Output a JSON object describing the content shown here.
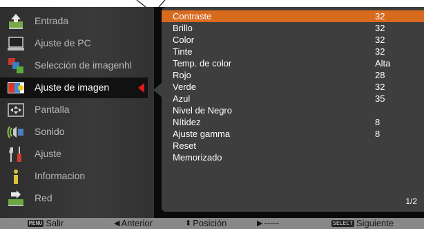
{
  "menu": {
    "items": [
      {
        "label": "Entrada",
        "icon": "input-icon",
        "active": false
      },
      {
        "label": "Ajuste de PC",
        "icon": "pc-icon",
        "active": false
      },
      {
        "label": "Selección de imagenhl",
        "icon": "image-select-icon",
        "active": false
      },
      {
        "label": "Ajuste de imagen",
        "icon": "image-adjust-icon",
        "active": true
      },
      {
        "label": "Pantalla",
        "icon": "screen-icon",
        "active": false
      },
      {
        "label": "Sonido",
        "icon": "speaker-icon",
        "active": false
      },
      {
        "label": "Ajuste",
        "icon": "tools-icon",
        "active": false
      },
      {
        "label": "Informacion",
        "icon": "info-icon",
        "active": false
      },
      {
        "label": "Red",
        "icon": "network-icon",
        "active": false
      }
    ]
  },
  "settings": {
    "rows": [
      {
        "name": "Contraste",
        "value": "32"
      },
      {
        "name": "Brillo",
        "value": "32"
      },
      {
        "name": "Color",
        "value": "32"
      },
      {
        "name": "Tinte",
        "value": "32"
      },
      {
        "name": "Temp. de color",
        "value": "Alta"
      },
      {
        "name": "Rojo",
        "value": "28"
      },
      {
        "name": "Verde",
        "value": "32"
      },
      {
        "name": "Azul",
        "value": "35"
      },
      {
        "name": "Nivel de Negro",
        "value": ""
      },
      {
        "name": "Nítidez",
        "value": "8"
      },
      {
        "name": "Ajuste gamma",
        "value": "8"
      },
      {
        "name": "Reset",
        "value": ""
      },
      {
        "name": "Memorizado",
        "value": ""
      }
    ],
    "page": "1/2"
  },
  "footer": {
    "menu_key": "MENU",
    "menu_label": "Salir",
    "left_label": "Anterior",
    "updown_label": "Posición",
    "right_label": "-----",
    "select_key": "SELECT",
    "select_label": "Siguiente"
  },
  "colors": {
    "highlight": "#d86a1e",
    "active_marker": "#e01818"
  }
}
